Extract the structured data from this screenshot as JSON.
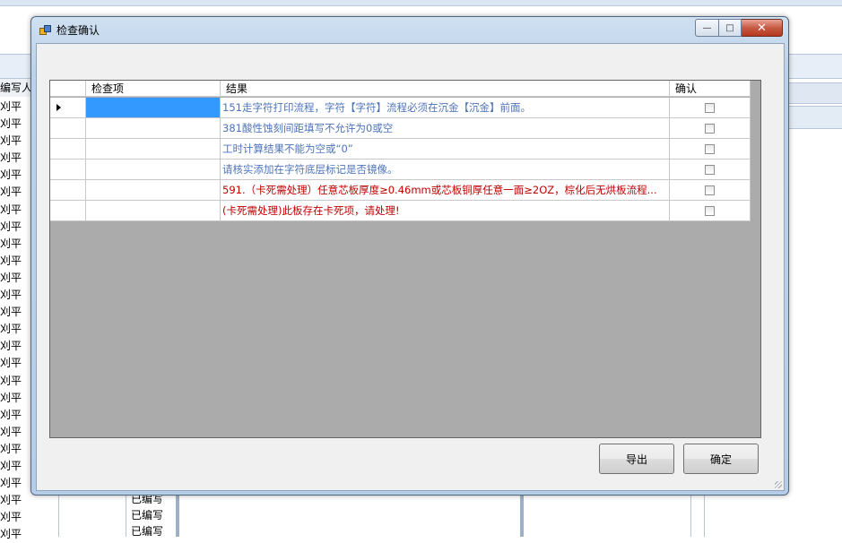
{
  "background": {
    "column_header": "编写人",
    "row_text": "刈平",
    "row_count": 26,
    "bottom_rows": [
      "已编写",
      "已编写",
      "已编写"
    ]
  },
  "dialog": {
    "title": "检查确认",
    "window_buttons": {
      "minimize": "—",
      "maximize": "□",
      "close": "✕"
    },
    "grid": {
      "columns": [
        "",
        "检查项",
        "结果",
        "确认"
      ],
      "rows": [
        {
          "item": "",
          "result": "151走字符打印流程，字符【字符】流程必须在沉金【沉金】前面。",
          "style": "blue",
          "confirmed": false,
          "current": true
        },
        {
          "item": "",
          "result": "381酸性蚀刻间距填写不允许为0或空",
          "style": "blue",
          "confirmed": false,
          "current": false
        },
        {
          "item": "",
          "result": "工时计算结果不能为空或“0”",
          "style": "blue",
          "confirmed": false,
          "current": false
        },
        {
          "item": "",
          "result": "请核实添加在字符底层标记是否镜像。",
          "style": "blue",
          "confirmed": false,
          "current": false
        },
        {
          "item": "",
          "result": "591.（卡死需处理）任意芯板厚度≥0.46mm或芯板铜厚任意一面≥2OZ，棕化后无烘板流程...",
          "style": "red",
          "confirmed": false,
          "current": false
        },
        {
          "item": "",
          "result": "(卡死需处理)此板存在卡死项，请处理!",
          "style": "red",
          "confirmed": false,
          "current": false
        }
      ]
    },
    "buttons": {
      "export": "导出",
      "ok": "确定"
    }
  }
}
